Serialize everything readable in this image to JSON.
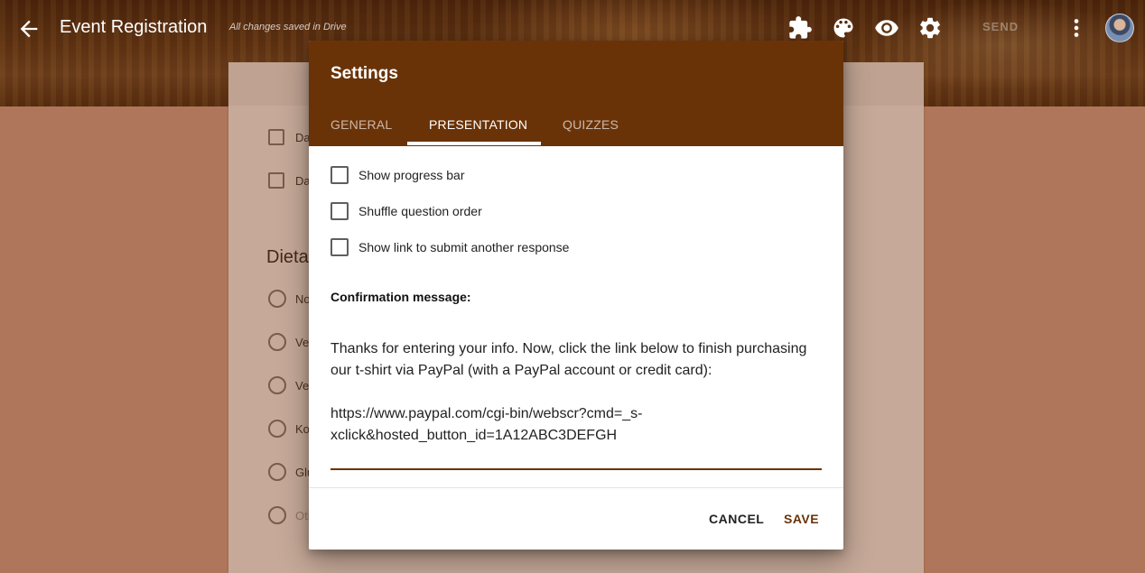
{
  "header": {
    "title": "Event Registration",
    "save_status": "All changes saved in Drive",
    "send_label": "SEND",
    "icons": [
      "back-arrow-icon",
      "puzzle-icon",
      "palette-icon",
      "eye-icon",
      "gear-icon",
      "more-vert-icon"
    ]
  },
  "form_background": {
    "checkbox_items": [
      "Da",
      "Da"
    ],
    "section_heading": "Dieta",
    "radio_items": [
      "No",
      "Ve",
      "Ve",
      "Ko",
      "Glu",
      "Oth"
    ]
  },
  "dialog": {
    "title": "Settings",
    "tabs": [
      {
        "label": "GENERAL",
        "active": false
      },
      {
        "label": "PRESENTATION",
        "active": true
      },
      {
        "label": "QUIZZES",
        "active": false
      }
    ],
    "options": [
      {
        "label": "Show progress bar",
        "checked": false
      },
      {
        "label": "Shuffle question order",
        "checked": false
      },
      {
        "label": "Show link to submit another response",
        "checked": false
      }
    ],
    "confirmation_label": "Confirmation message:",
    "confirmation_paragraph_1": "Thanks for entering your info. Now, click the link below to finish purchasing our t-shirt via PayPal (with a PayPal account or credit card):",
    "confirmation_paragraph_2": "https://www.paypal.com/cgi-bin/webscr?cmd=_s-xclick&hosted_button_id=1A12ABC3DEFGH",
    "cancel_label": "CANCEL",
    "save_label": "SAVE"
  },
  "colors": {
    "accent": "#6a3307",
    "scrim": "rgba(120,50,10,0.42)"
  }
}
